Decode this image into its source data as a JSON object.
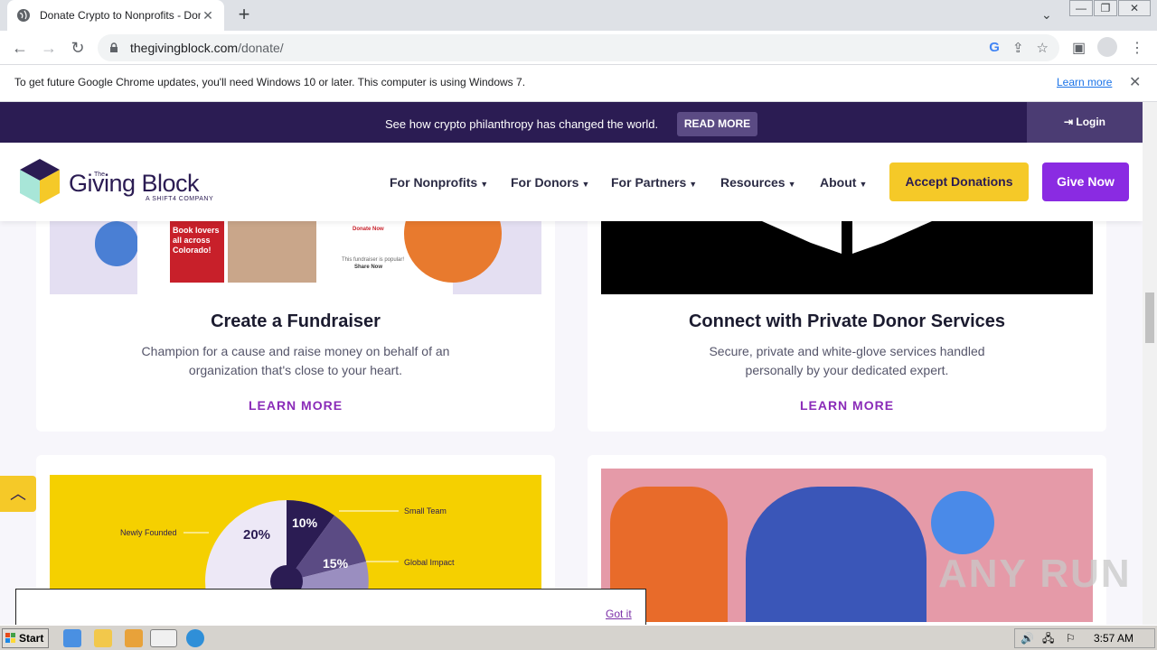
{
  "browser": {
    "tab_title": "Donate Crypto to Nonprofits - Dona",
    "tab_close": "✕",
    "new_tab": "+",
    "tab_list": "⌄",
    "url_domain": "thegivingblock.com",
    "url_path": "/donate/",
    "back": "←",
    "forward": "→",
    "reload": "↻",
    "win_min": "—",
    "win_restore": "❐",
    "win_close": "✕"
  },
  "infobar": {
    "message": "To get future Google Chrome updates, you'll need Windows 10 or later. This computer is using Windows 7.",
    "learn_more": "Learn more",
    "close": "✕"
  },
  "promo": {
    "text": "See how crypto philanthropy has changed the world.",
    "button": "READ MORE",
    "login": "Login"
  },
  "site": {
    "logo_the": "The",
    "logo_name": "Giving Block",
    "logo_sub": "A SHIFT4 COMPANY",
    "menu": [
      "For Nonprofits",
      "For Donors",
      "For Partners",
      "Resources",
      "About"
    ],
    "accept_donations": "Accept Donations",
    "give_now": "Give Now",
    "colors": {
      "navy": "#2b1c53",
      "yellow": "#f5c928",
      "purple": "#8a2be2"
    }
  },
  "cards": [
    {
      "title": "Create a Fundraiser",
      "desc": [
        "Champion for a cause and raise money on behalf of an",
        "organization that's close to your heart."
      ],
      "link": "LEARN MORE",
      "image_text": [
        "Book lovers",
        "all across",
        "Colorado!",
        "Donate Now",
        "This fundraiser is popular!",
        "Share Now"
      ]
    },
    {
      "title": "Connect with Private Donor Services",
      "desc": [
        "Secure, private and white-glove services handled",
        "personally by your dedicated expert."
      ],
      "link": "LEARN MORE"
    }
  ],
  "chart_card": {
    "labels": [
      "Newly Founded",
      "Small Team",
      "Global Impact"
    ],
    "pct_20": "20%",
    "pct_10": "10%",
    "pct_15": "15%"
  },
  "cookie": {
    "got_it": "Got it"
  },
  "watermark": "ANY RUN",
  "taskbar": {
    "start": "Start",
    "clock": "3:57 AM"
  }
}
